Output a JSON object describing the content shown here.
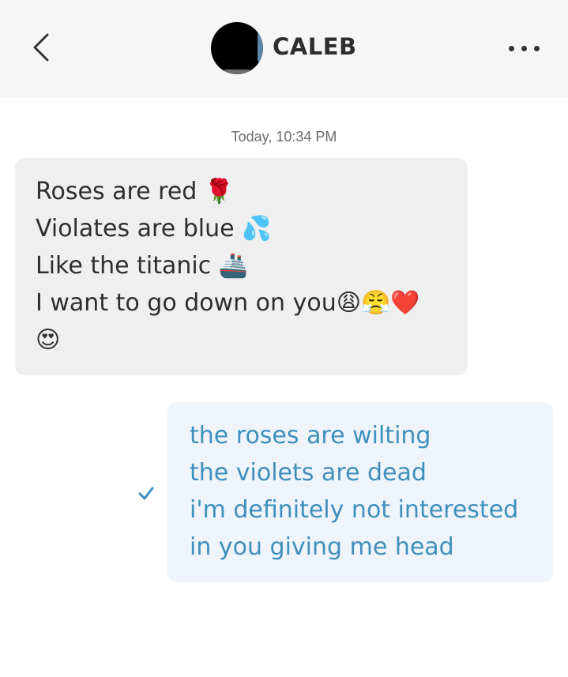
{
  "header": {
    "contact_name": "CALEB",
    "back_icon": "chevron-left-icon",
    "more_icon": "more-horizontal-icon"
  },
  "conversation": {
    "timestamp": "Today, 10:34 PM",
    "received": {
      "lines": [
        "Roses are red 🌹",
        "Violates are blue 💦",
        "Like the titanic 🚢",
        "I want to go down on you😩😤❤️",
        "😍"
      ]
    },
    "sent": {
      "lines": [
        "the roses are wilting",
        "the violets are dead",
        "i'm definitely not interested",
        "in you giving me head"
      ],
      "status_icon": "checkmark-icon"
    }
  },
  "colors": {
    "header_bg": "#f6f6f6",
    "received_bubble": "#efefef",
    "sent_bubble": "#eef4fa",
    "sent_text": "#3f8fbd",
    "check": "#3f8fbd"
  }
}
